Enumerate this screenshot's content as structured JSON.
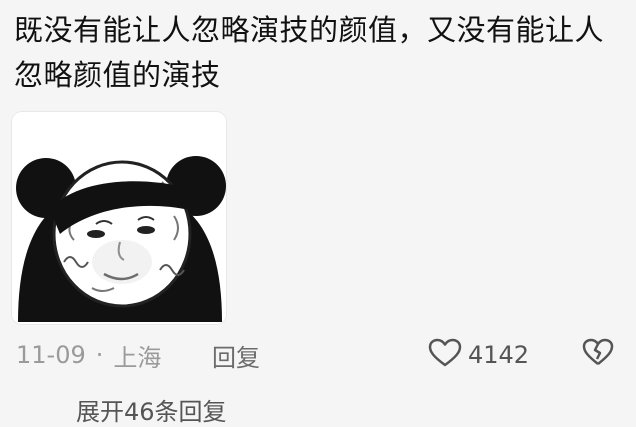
{
  "comment": {
    "text": "既没有能让人忽略演技的颜值，又没有能让人忽略颜值的演技"
  },
  "sticker": {
    "icon": "panda-meme-sticker"
  },
  "meta": {
    "date": "11-09",
    "separator": "·",
    "location": "上海",
    "reply_label": "回复"
  },
  "actions": {
    "like_icon": "heart-outline-icon",
    "like_count": "4142",
    "dislike_icon": "broken-heart-icon"
  },
  "replies": {
    "expand_label": "展开46条回复"
  }
}
